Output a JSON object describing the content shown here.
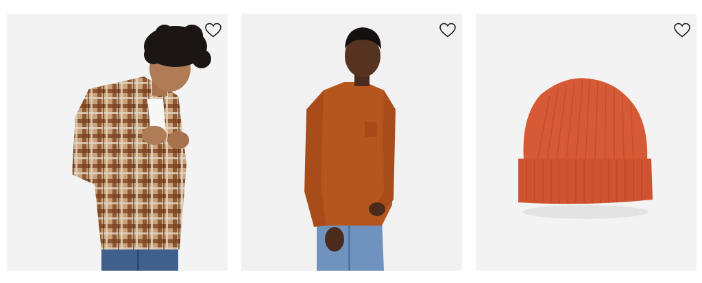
{
  "products": [
    {
      "name": "model-in-plaid-flannel-shirt",
      "icon": "heart-outline-icon"
    },
    {
      "name": "model-in-orange-long-sleeve-pocket-tee",
      "icon": "heart-outline-icon"
    },
    {
      "name": "orange-ribbed-beanie",
      "icon": "heart-outline-icon"
    }
  ],
  "colors": {
    "card_bg": "#f4f4f4",
    "plaid_brown": "#7a3f1c",
    "tee_orange": "#b5561f",
    "beanie_orange": "#d65a35",
    "denim": "#4a6f9a"
  }
}
